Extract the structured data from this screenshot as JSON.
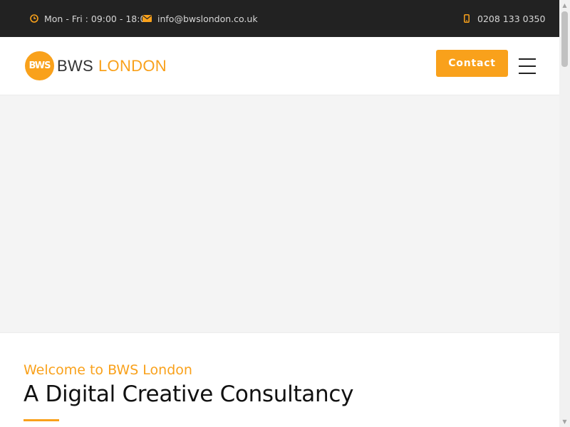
{
  "topbar": {
    "hours": "Mon - Fri : 09:00 - 18:00",
    "email": "info@bwslondon.co.uk",
    "phone": "0208 133 0350",
    "icons": {
      "hours": "clock-icon",
      "email": "envelope-icon",
      "phone": "mobile-phone-icon"
    }
  },
  "header": {
    "logo": {
      "badge": "BWS",
      "name": "BWS",
      "accent": "LONDON"
    },
    "contact_label": "Contact",
    "menu_icon": "hamburger-menu-icon"
  },
  "intro": {
    "welcome": "Welcome to BWS London",
    "headline": "A Digital Creative Consultancy"
  },
  "colors": {
    "accent": "#f9a11b",
    "topbar": "#222222",
    "hero": "#f4f4f4"
  }
}
